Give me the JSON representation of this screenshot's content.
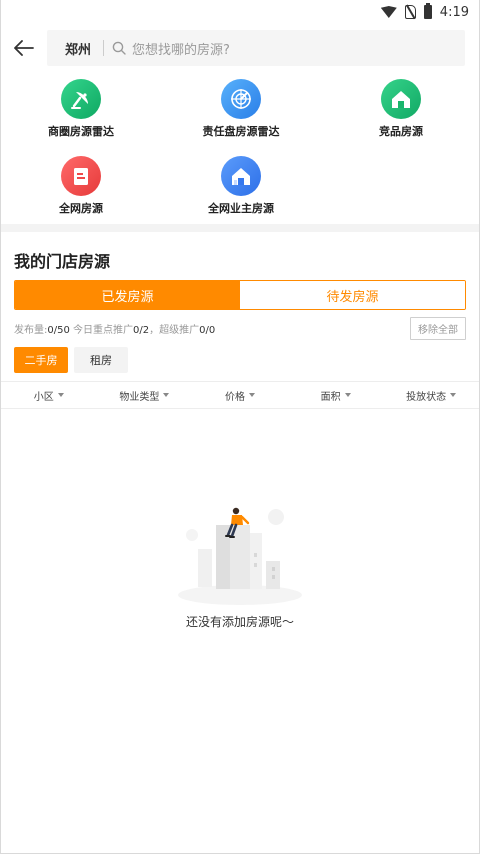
{
  "status_bar": {
    "time": "4:19"
  },
  "search": {
    "city": "郑州",
    "placeholder": "您想找哪的房源?"
  },
  "entries": [
    {
      "label": "商圈房源雷达",
      "icon": "radar-dish-icon",
      "color": "#1fbf7a"
    },
    {
      "label": "责任盘房源雷达",
      "icon": "radar-scope-icon",
      "color": "#3a8ef0"
    },
    {
      "label": "竞品房源",
      "icon": "house-green-icon",
      "color": "#1cbf74"
    },
    {
      "label": "全网房源",
      "icon": "document-red-icon",
      "color": "#f24a4a"
    },
    {
      "label": "全网业主房源",
      "icon": "house-blue-icon",
      "color": "#3a7ef2"
    }
  ],
  "section": {
    "title": "我的门店房源"
  },
  "tabs": {
    "published": "已发房源",
    "pending": "待发房源"
  },
  "stats": {
    "label_publish": "发布量:",
    "publish": "0/50",
    "label_key": " 今日重点推广",
    "key": "0/2",
    "label_super": "，超级推广",
    "super": "0/0",
    "remove_all": "移除全部"
  },
  "chips": {
    "second_hand": "二手房",
    "rent": "租房"
  },
  "filters": [
    "小区",
    "物业类型",
    "价格",
    "面积",
    "投放状态"
  ],
  "empty": {
    "text": "还没有添加房源呢～"
  },
  "colors": {
    "accent": "#ff8a00"
  }
}
